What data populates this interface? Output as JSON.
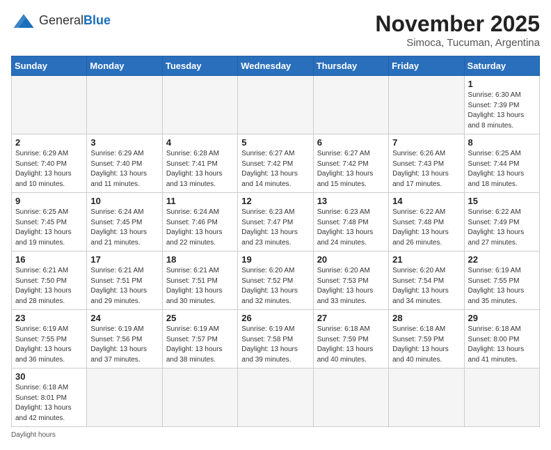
{
  "header": {
    "logo_general": "General",
    "logo_blue": "Blue",
    "month_title": "November 2025",
    "location": "Simoca, Tucuman, Argentina"
  },
  "days_of_week": [
    "Sunday",
    "Monday",
    "Tuesday",
    "Wednesday",
    "Thursday",
    "Friday",
    "Saturday"
  ],
  "weeks": [
    [
      {
        "day": "",
        "info": ""
      },
      {
        "day": "",
        "info": ""
      },
      {
        "day": "",
        "info": ""
      },
      {
        "day": "",
        "info": ""
      },
      {
        "day": "",
        "info": ""
      },
      {
        "day": "",
        "info": ""
      },
      {
        "day": "1",
        "info": "Sunrise: 6:30 AM\nSunset: 7:39 PM\nDaylight: 13 hours\nand 8 minutes."
      }
    ],
    [
      {
        "day": "2",
        "info": "Sunrise: 6:29 AM\nSunset: 7:40 PM\nDaylight: 13 hours\nand 10 minutes."
      },
      {
        "day": "3",
        "info": "Sunrise: 6:29 AM\nSunset: 7:40 PM\nDaylight: 13 hours\nand 11 minutes."
      },
      {
        "day": "4",
        "info": "Sunrise: 6:28 AM\nSunset: 7:41 PM\nDaylight: 13 hours\nand 13 minutes."
      },
      {
        "day": "5",
        "info": "Sunrise: 6:27 AM\nSunset: 7:42 PM\nDaylight: 13 hours\nand 14 minutes."
      },
      {
        "day": "6",
        "info": "Sunrise: 6:27 AM\nSunset: 7:42 PM\nDaylight: 13 hours\nand 15 minutes."
      },
      {
        "day": "7",
        "info": "Sunrise: 6:26 AM\nSunset: 7:43 PM\nDaylight: 13 hours\nand 17 minutes."
      },
      {
        "day": "8",
        "info": "Sunrise: 6:25 AM\nSunset: 7:44 PM\nDaylight: 13 hours\nand 18 minutes."
      }
    ],
    [
      {
        "day": "9",
        "info": "Sunrise: 6:25 AM\nSunset: 7:45 PM\nDaylight: 13 hours\nand 19 minutes."
      },
      {
        "day": "10",
        "info": "Sunrise: 6:24 AM\nSunset: 7:45 PM\nDaylight: 13 hours\nand 21 minutes."
      },
      {
        "day": "11",
        "info": "Sunrise: 6:24 AM\nSunset: 7:46 PM\nDaylight: 13 hours\nand 22 minutes."
      },
      {
        "day": "12",
        "info": "Sunrise: 6:23 AM\nSunset: 7:47 PM\nDaylight: 13 hours\nand 23 minutes."
      },
      {
        "day": "13",
        "info": "Sunrise: 6:23 AM\nSunset: 7:48 PM\nDaylight: 13 hours\nand 24 minutes."
      },
      {
        "day": "14",
        "info": "Sunrise: 6:22 AM\nSunset: 7:48 PM\nDaylight: 13 hours\nand 26 minutes."
      },
      {
        "day": "15",
        "info": "Sunrise: 6:22 AM\nSunset: 7:49 PM\nDaylight: 13 hours\nand 27 minutes."
      }
    ],
    [
      {
        "day": "16",
        "info": "Sunrise: 6:21 AM\nSunset: 7:50 PM\nDaylight: 13 hours\nand 28 minutes."
      },
      {
        "day": "17",
        "info": "Sunrise: 6:21 AM\nSunset: 7:51 PM\nDaylight: 13 hours\nand 29 minutes."
      },
      {
        "day": "18",
        "info": "Sunrise: 6:21 AM\nSunset: 7:51 PM\nDaylight: 13 hours\nand 30 minutes."
      },
      {
        "day": "19",
        "info": "Sunrise: 6:20 AM\nSunset: 7:52 PM\nDaylight: 13 hours\nand 32 minutes."
      },
      {
        "day": "20",
        "info": "Sunrise: 6:20 AM\nSunset: 7:53 PM\nDaylight: 13 hours\nand 33 minutes."
      },
      {
        "day": "21",
        "info": "Sunrise: 6:20 AM\nSunset: 7:54 PM\nDaylight: 13 hours\nand 34 minutes."
      },
      {
        "day": "22",
        "info": "Sunrise: 6:19 AM\nSunset: 7:55 PM\nDaylight: 13 hours\nand 35 minutes."
      }
    ],
    [
      {
        "day": "23",
        "info": "Sunrise: 6:19 AM\nSunset: 7:55 PM\nDaylight: 13 hours\nand 36 minutes."
      },
      {
        "day": "24",
        "info": "Sunrise: 6:19 AM\nSunset: 7:56 PM\nDaylight: 13 hours\nand 37 minutes."
      },
      {
        "day": "25",
        "info": "Sunrise: 6:19 AM\nSunset: 7:57 PM\nDaylight: 13 hours\nand 38 minutes."
      },
      {
        "day": "26",
        "info": "Sunrise: 6:19 AM\nSunset: 7:58 PM\nDaylight: 13 hours\nand 39 minutes."
      },
      {
        "day": "27",
        "info": "Sunrise: 6:18 AM\nSunset: 7:59 PM\nDaylight: 13 hours\nand 40 minutes."
      },
      {
        "day": "28",
        "info": "Sunrise: 6:18 AM\nSunset: 7:59 PM\nDaylight: 13 hours\nand 40 minutes."
      },
      {
        "day": "29",
        "info": "Sunrise: 6:18 AM\nSunset: 8:00 PM\nDaylight: 13 hours\nand 41 minutes."
      }
    ],
    [
      {
        "day": "30",
        "info": "Sunrise: 6:18 AM\nSunset: 8:01 PM\nDaylight: 13 hours\nand 42 minutes."
      },
      {
        "day": "",
        "info": ""
      },
      {
        "day": "",
        "info": ""
      },
      {
        "day": "",
        "info": ""
      },
      {
        "day": "",
        "info": ""
      },
      {
        "day": "",
        "info": ""
      },
      {
        "day": "",
        "info": ""
      }
    ]
  ],
  "footer": {
    "note": "Daylight hours"
  }
}
